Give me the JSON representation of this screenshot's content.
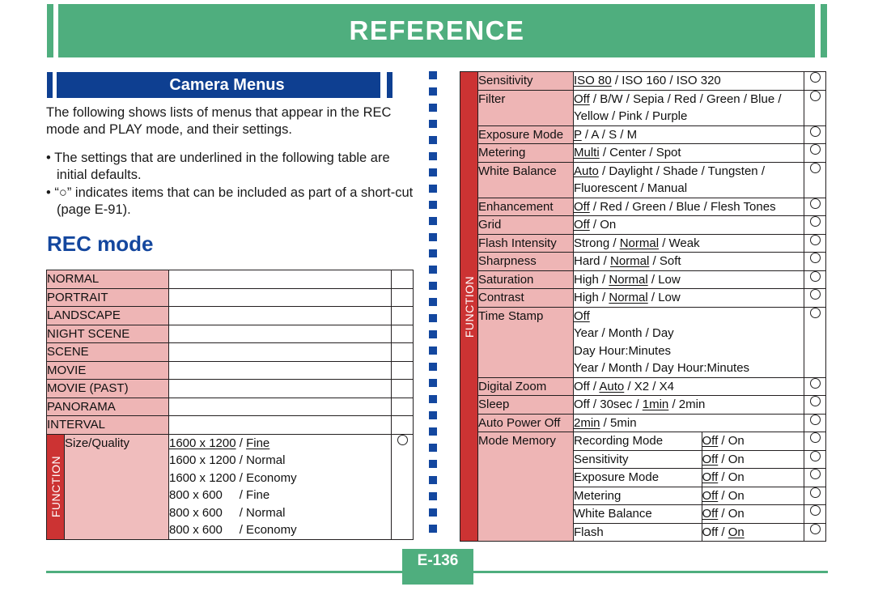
{
  "header": {
    "title": "REFERENCE",
    "accent_color": "#4fae7e"
  },
  "section": {
    "title": "Camera Menus",
    "accent_color": "#0e3f91"
  },
  "intro": {
    "paragraph": "The following shows lists of menus that appear in the REC mode and PLAY mode, and their settings.",
    "bullets": [
      "• The settings that are underlined in the following table are initial defaults.",
      "• “○” indicates items that can be included as part of a short-cut (page E-91)."
    ]
  },
  "rec_mode": {
    "heading": "REC mode",
    "function_label": "FUNCTION",
    "modes": [
      "NORMAL",
      "PORTRAIT",
      "LANDSCAPE",
      "NIGHT SCENE",
      "SCENE",
      "MOVIE",
      "MOVIE (PAST)",
      "PANORAMA",
      "INTERVAL"
    ],
    "size_quality": {
      "label": "Size/Quality",
      "options": [
        {
          "size": "1600 x 1200",
          "sep": "/",
          "quality": "Fine",
          "default": true
        },
        {
          "size": "1600 x 1200",
          "sep": "/",
          "quality": "Normal",
          "default": false
        },
        {
          "size": "1600 x 1200",
          "sep": "/",
          "quality": "Economy",
          "default": false
        },
        {
          "size": "800 x 600",
          "sep": "/",
          "quality": "Fine",
          "default": false
        },
        {
          "size": "800 x 600",
          "sep": "/",
          "quality": "Normal",
          "default": false
        },
        {
          "size": "800 x 600",
          "sep": "/",
          "quality": "Economy",
          "default": false
        }
      ],
      "shortcut": true
    }
  },
  "function_table": {
    "function_label": "FUNCTION",
    "rows": [
      {
        "name": "Sensitivity",
        "values": "ISO 80 / ISO 160 / ISO 320",
        "default": "ISO 80",
        "shortcut": true
      },
      {
        "name": "Filter",
        "values": "Off / B/W / Sepia / Red / Green / Blue / Yellow / Pink / Purple",
        "default": "Off",
        "shortcut": true
      },
      {
        "name": "Exposure Mode",
        "values": "P / A / S / M",
        "default": "P",
        "shortcut": true
      },
      {
        "name": "Metering",
        "values": "Multi / Center / Spot",
        "default": "Multi",
        "shortcut": true
      },
      {
        "name": "White Balance",
        "values": "Auto / Daylight / Shade / Tungsten / Fluorescent / Manual",
        "default": "Auto",
        "shortcut": true
      },
      {
        "name": "Enhancement",
        "values": "Off / Red / Green / Blue / Flesh Tones",
        "default": "Off",
        "shortcut": true
      },
      {
        "name": "Grid",
        "values": "Off / On",
        "default": "Off",
        "shortcut": true
      },
      {
        "name": "Flash Intensity",
        "values": "Strong / Normal / Weak",
        "default": "Normal",
        "shortcut": true
      },
      {
        "name": "Sharpness",
        "values": "Hard / Normal / Soft",
        "default": "Normal",
        "shortcut": true
      },
      {
        "name": "Saturation",
        "values": "High / Normal / Low",
        "default": "Normal",
        "shortcut": true
      },
      {
        "name": "Contrast",
        "values": "High / Normal / Low",
        "default": "Normal",
        "shortcut": true
      },
      {
        "name": "Time Stamp",
        "values": "Off | Year / Month / Day | Day  Hour:Minutes | Year / Month / Day  Hour:Minutes",
        "default": "Off",
        "shortcut": true
      },
      {
        "name": "Digital Zoom",
        "values": "Off / Auto / X2 / X4",
        "default": "Auto",
        "shortcut": true
      },
      {
        "name": "Sleep",
        "values": "Off / 30sec / 1min / 2min",
        "default": "1min",
        "shortcut": true
      },
      {
        "name": "Auto Power Off",
        "values": "2min / 5min",
        "default": "2min",
        "shortcut": true
      }
    ],
    "time_stamp_lines": [
      {
        "text": "Off",
        "default": true
      },
      {
        "text": "Year / Month / Day",
        "default": false
      },
      {
        "text": "Day  Hour:Minutes",
        "default": false
      },
      {
        "text": "Year / Month / Day  Hour:Minutes",
        "default": false
      }
    ],
    "mode_memory": {
      "label": "Mode Memory",
      "items": [
        {
          "name": "Recording Mode",
          "values": "Off / On",
          "default": "Off",
          "shortcut": true
        },
        {
          "name": "Sensitivity",
          "values": "Off / On",
          "default": "Off",
          "shortcut": true
        },
        {
          "name": "Exposure Mode",
          "values": "Off / On",
          "default": "Off",
          "shortcut": true
        },
        {
          "name": "Metering",
          "values": "Off / On",
          "default": "Off",
          "shortcut": true
        },
        {
          "name": "White Balance",
          "values": "Off / On",
          "default": "Off",
          "shortcut": true
        },
        {
          "name": "Flash",
          "values": "Off / On",
          "default": "On",
          "shortcut": true
        }
      ]
    }
  },
  "footer": {
    "page": "E-136"
  }
}
